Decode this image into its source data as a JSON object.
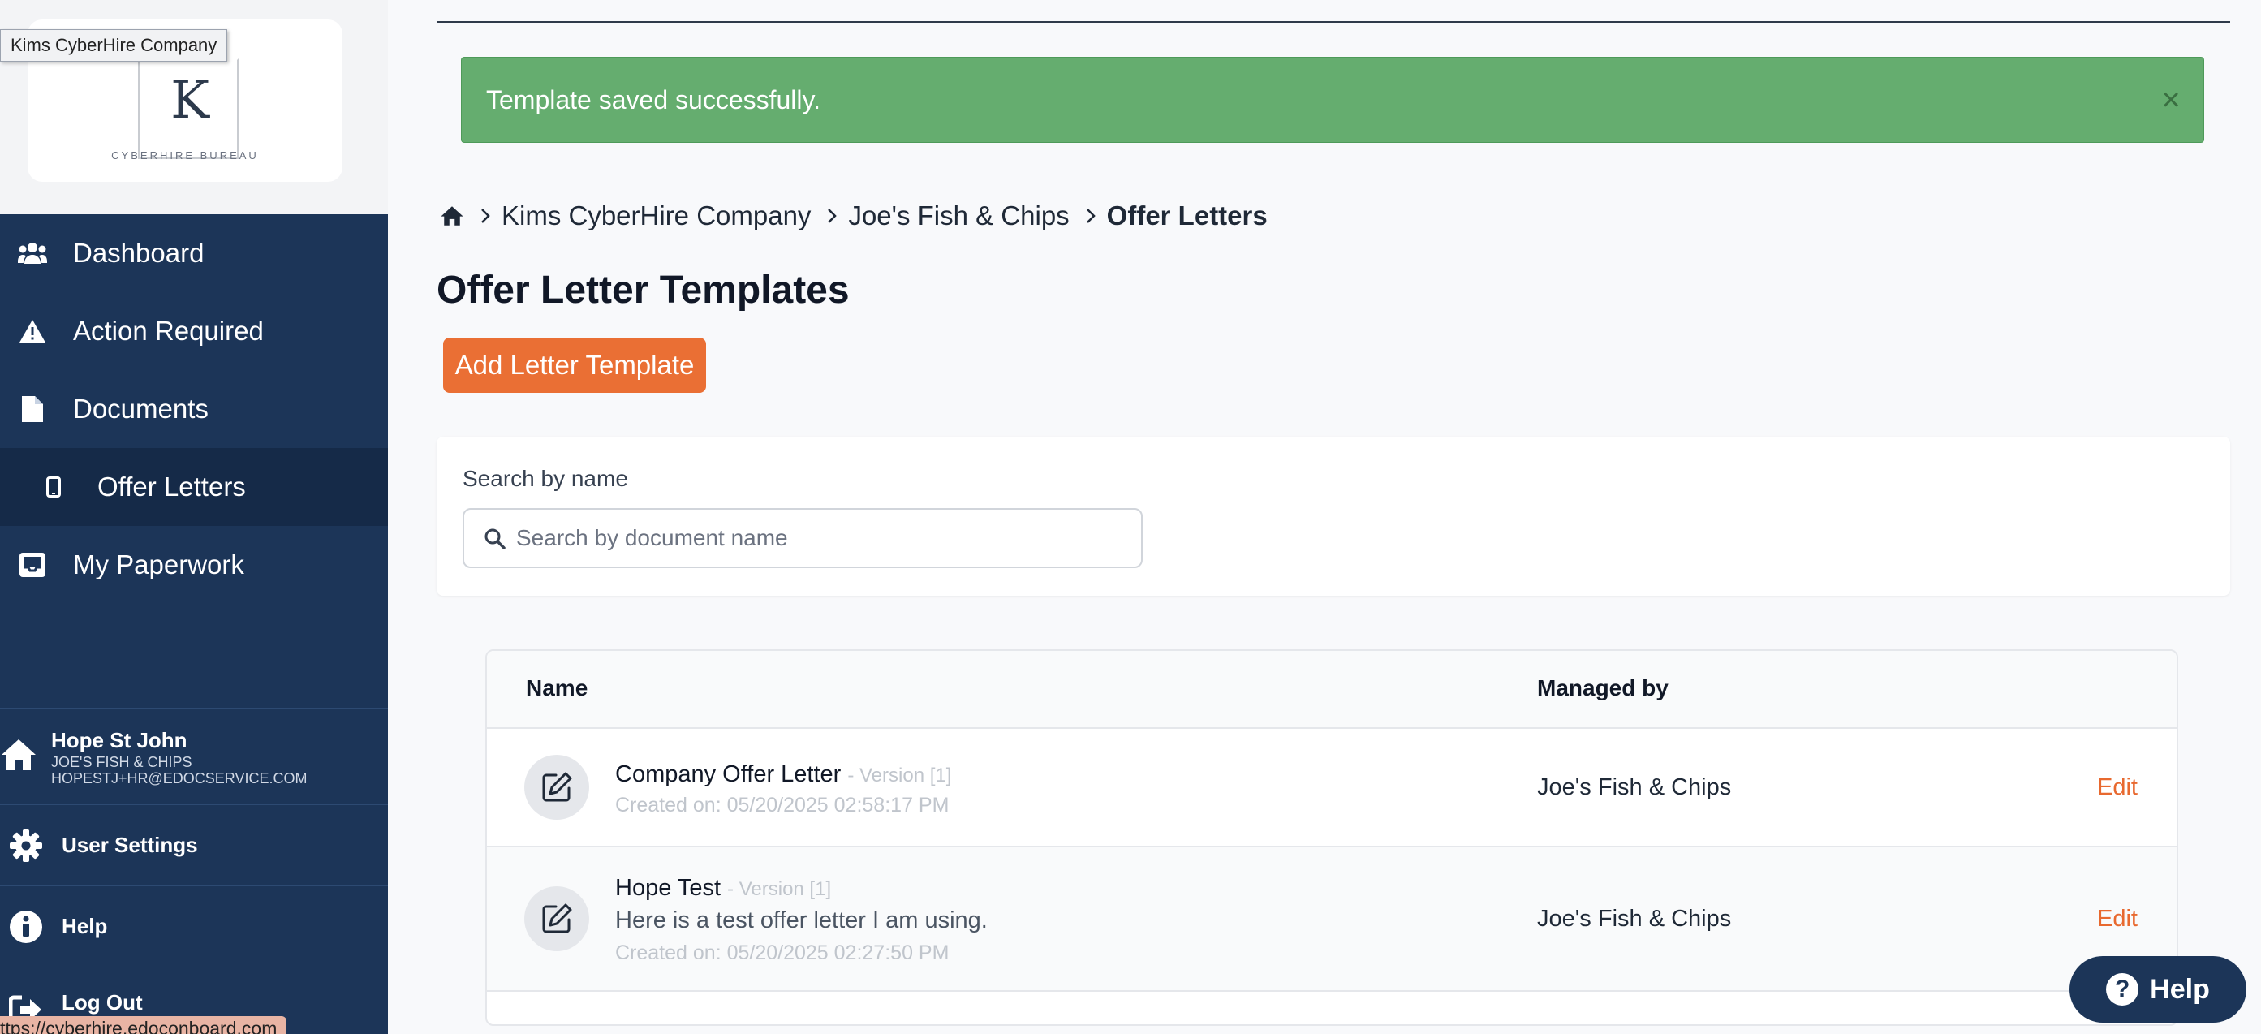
{
  "sidebar": {
    "logo_letter": "K",
    "logo_caption": "CYBERHIRE BUREAU",
    "company_tooltip": "Kims CyberHire Company",
    "nav": [
      {
        "label": "Dashboard",
        "icon": "users-icon"
      },
      {
        "label": "Action Required",
        "icon": "warning-icon"
      },
      {
        "label": "Documents",
        "icon": "document-icon"
      },
      {
        "label": "Offer Letters",
        "icon": "tablet-icon"
      },
      {
        "label": "My Paperwork",
        "icon": "inbox-icon"
      }
    ],
    "user": {
      "name": "Hope St John",
      "company": "JOE'S FISH & CHIPS",
      "email": "HOPESTJ+HR@EDOCSERVICE.COM"
    },
    "user_settings": "User Settings",
    "help": "Help",
    "logout": "Log Out"
  },
  "status_bar_url": "ttps://cyberhire.edoconboard.com",
  "alert": {
    "message": "Template saved successfully.",
    "close": "×"
  },
  "breadcrumb": {
    "items": [
      "Kims CyberHire Company",
      "Joe's Fish & Chips"
    ],
    "current": "Offer Letters"
  },
  "page_title": "Offer Letter Templates",
  "add_button": "Add Letter Template",
  "search": {
    "label": "Search by name",
    "placeholder": "Search by document name",
    "value": ""
  },
  "table": {
    "headers": {
      "name": "Name",
      "managed_by": "Managed by"
    },
    "rows": [
      {
        "title": "Company Offer Letter",
        "version": "- Version [1]",
        "description": "",
        "created": "Created on: 05/20/2025 02:58:17 PM",
        "managed_by": "Joe's Fish & Chips",
        "action": "Edit"
      },
      {
        "title": "Hope Test",
        "version": "- Version [1]",
        "description": "Here is a test offer letter I am using.",
        "created": "Created on: 05/20/2025 02:27:50 PM",
        "managed_by": "Joe's Fish & Chips",
        "action": "Edit"
      }
    ]
  },
  "help_button": "Help",
  "colors": {
    "sidebar_bg": "#1c3558",
    "accent": "#ea6f34",
    "success": "#65ad6f"
  }
}
